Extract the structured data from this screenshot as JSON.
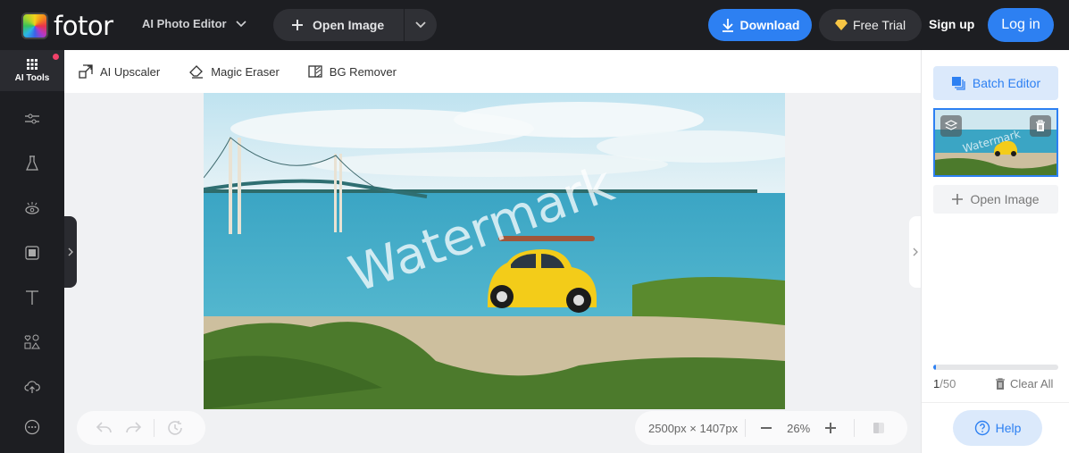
{
  "header": {
    "logo_text": "fotor",
    "editor_menu": "AI Photo Editor",
    "open_image": "Open Image",
    "download": "Download",
    "free_trial": "Free Trial",
    "sign_up": "Sign up",
    "log_in": "Log in"
  },
  "left_sidebar": {
    "ai_tools_label": "AI Tools",
    "items": [
      "adjust",
      "effects",
      "beauty",
      "frames",
      "text",
      "elements",
      "uploads",
      "more"
    ]
  },
  "tools_bar": {
    "items": [
      {
        "label": "AI Upscaler",
        "icon": "upscale-icon"
      },
      {
        "label": "Magic Eraser",
        "icon": "eraser-icon"
      },
      {
        "label": "BG Remover",
        "icon": "bg-remove-icon"
      }
    ]
  },
  "canvas": {
    "watermark_text": "Watermark",
    "dimensions": "2500px × 1407px",
    "zoom": "26%"
  },
  "right_panel": {
    "batch_editor": "Batch Editor",
    "thumbnail_watermark": "Watermark",
    "open_image": "Open Image",
    "count_current": "1",
    "count_text": "/50",
    "progress_fraction": 0.02,
    "clear_all": "Clear All",
    "help": "Help"
  },
  "colors": {
    "accent": "#2d80f2",
    "topbar": "#1d1e22",
    "notification_dot": "#f2426a"
  }
}
